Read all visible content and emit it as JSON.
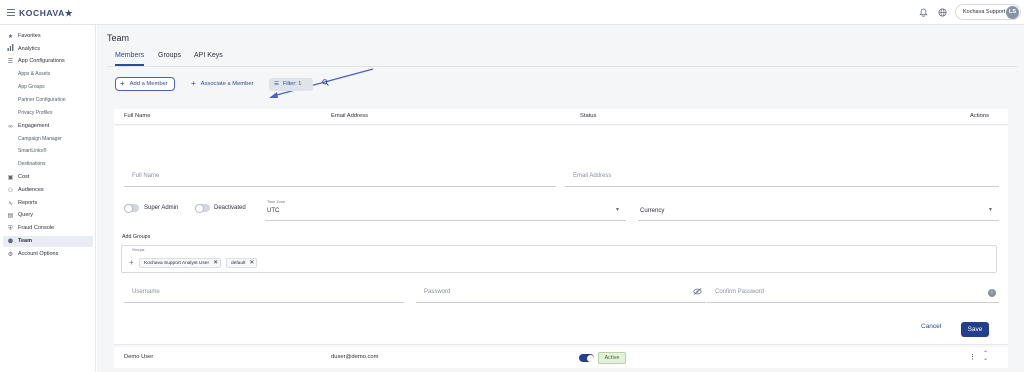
{
  "brand": {
    "name": "KOCHAVA★"
  },
  "topbar": {
    "user_name": "Kochava Support",
    "user_initials": "LS"
  },
  "sidebar": {
    "items": [
      {
        "label": "Favorites",
        "icon": "star-icon"
      },
      {
        "label": "Analytics",
        "icon": "bar-chart-icon"
      },
      {
        "label": "App Configurations",
        "icon": "list-icon"
      },
      {
        "label": "Apps & Assets",
        "sub": true
      },
      {
        "label": "App Groups",
        "sub": true
      },
      {
        "label": "Partner Configuration",
        "sub": true
      },
      {
        "label": "Privacy Profiles",
        "sub": true
      },
      {
        "label": "Engagement",
        "icon": "link-icon"
      },
      {
        "label": "Campaign Manager",
        "sub": true
      },
      {
        "label": "SmartLinks®",
        "sub": true
      },
      {
        "label": "Destinations",
        "sub": true
      },
      {
        "label": "Cost",
        "icon": "cost-icon"
      },
      {
        "label": "Audiences",
        "icon": "audiences-icon"
      },
      {
        "label": "Reports",
        "icon": "reports-icon"
      },
      {
        "label": "Query",
        "icon": "database-icon"
      },
      {
        "label": "Fraud Console",
        "icon": "shield-icon"
      },
      {
        "label": "Team",
        "icon": "team-icon",
        "active": true
      },
      {
        "label": "Account Options",
        "icon": "account-options-icon"
      }
    ]
  },
  "page": {
    "title": "Team",
    "tabs": [
      "Members",
      "Groups",
      "API Keys"
    ],
    "active_tab": "Members"
  },
  "toolbar": {
    "add_member": "Add a Member",
    "associate_member": "Associate a Member",
    "filter": "Filter:",
    "filter_count": "1"
  },
  "table": {
    "headers": [
      "Full Name",
      "Email Address",
      "Status",
      "Actions"
    ]
  },
  "form": {
    "full_name_placeholder": "Full Name",
    "email_placeholder": "Email Address",
    "super_admin_label": "Super Admin",
    "deactivated_label": "Deactivated",
    "timezone_label": "Time Zone",
    "timezone_value": "UTC",
    "currency_placeholder": "Currency",
    "add_groups_label": "Add Groups",
    "groups_label": "Groups",
    "groups": [
      "Kochava Support Analyst User",
      "default"
    ],
    "username_placeholder": "Username",
    "password_placeholder": "Password",
    "confirm_password_placeholder": "Confirm Password",
    "cancel": "Cancel",
    "save": "Save"
  },
  "rows": [
    {
      "name": "Demo User",
      "email": "duser@demo.com",
      "status": "Active"
    }
  ],
  "colors": {
    "accent": "#23408e",
    "highlight_outline": "#4a5fd0",
    "active_badge_bg": "#e5f1dd"
  }
}
